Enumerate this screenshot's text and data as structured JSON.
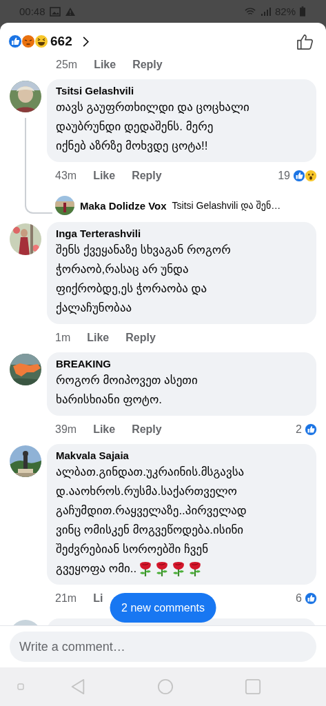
{
  "status_bar": {
    "time": "00:48",
    "battery": "82%"
  },
  "header": {
    "reactions": [
      {
        "kind": "like"
      },
      {
        "kind": "angry"
      },
      {
        "kind": "haha"
      }
    ],
    "count": "662"
  },
  "top_meta": {
    "time": "25m",
    "like": "Like",
    "reply": "Reply"
  },
  "comments": [
    {
      "author": "Tsitsi Gelashvili",
      "lines": [
        "თავს გაუფრთხილდი და ცოცხალი",
        "დაუბრუნდი დედაშენს. მერე",
        "იქნებ აზრზე მოხვდე ცოტა!!"
      ],
      "time": "43m",
      "like": "Like",
      "reply": "Reply",
      "reaction_count": "19",
      "reactions": [
        {
          "kind": "like"
        },
        {
          "kind": "wow"
        }
      ],
      "reply_preview": {
        "author": "Maka Dolidze Vox",
        "text": "Tsitsi Gelashvili და შენ…"
      }
    },
    {
      "author": "Inga Terterashvili",
      "lines": [
        "შენს ქვეყანაზე სხვაგან როგორ",
        "ჭორაობ,რასაც არ უნდა",
        "ფიქრობდე,ეს ჭორაობა და",
        "ქალაჩუნობაა"
      ],
      "time": "1m",
      "like": "Like",
      "reply": "Reply"
    },
    {
      "author": "BREAKING",
      "lines": [
        "როგორ მოიპოვეთ ასეთი",
        "ხარისხიანი ფოტო."
      ],
      "time": "39m",
      "like": "Like",
      "reply": "Reply",
      "reaction_count": "2",
      "reactions": [
        {
          "kind": "like"
        }
      ]
    },
    {
      "author": "Makvala Sajaia",
      "lines": [
        "ალბათ.გინდათ.უკრაინის.მსგავსა",
        "დ.ააოხროს.რუსმა.საქართველო",
        "გაჩუმდით.რაყველაზე..პირველად",
        "ვინც ომისკენ მოგვეწოდება.ისინი",
        "შეძვრებიან სოროებში ჩვენ",
        "გვეყოფა ომი.."
      ],
      "decorations": [
        {
          "kind": "rose"
        },
        {
          "kind": "rose"
        },
        {
          "kind": "rose"
        },
        {
          "kind": "rose"
        }
      ],
      "time": "21m",
      "like": "Li",
      "reaction_count": "6",
      "reactions": [
        {
          "kind": "like"
        }
      ]
    }
  ],
  "new_comments_button": "2 new comments",
  "composer": {
    "placeholder": "Write a comment…"
  }
}
